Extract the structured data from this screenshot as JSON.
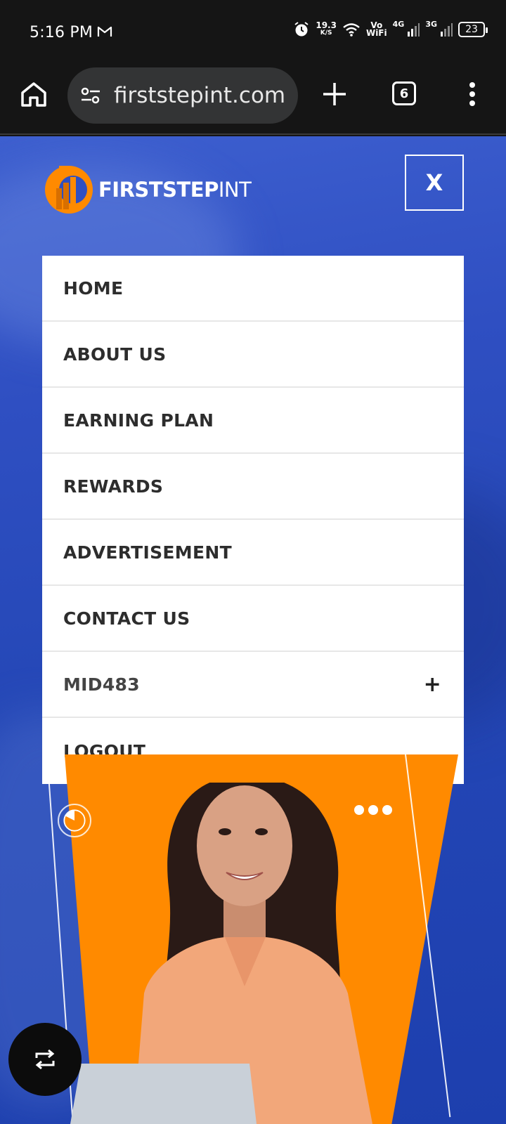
{
  "status_bar": {
    "time": "5:16 PM",
    "speed_value": "19.3",
    "speed_unit": "K/S",
    "volte_top": "Vo",
    "volte_bottom": "WiFi",
    "net1": "4G",
    "net2": "3G",
    "battery": "23"
  },
  "browser": {
    "url": "firststepint.com",
    "tab_count": "6"
  },
  "site": {
    "logo_bold": "FIRSTSTEP",
    "logo_light": "INT",
    "close_label": "X",
    "menu": [
      {
        "label": "HOME"
      },
      {
        "label": "ABOUT US"
      },
      {
        "label": "EARNING PLAN"
      },
      {
        "label": "REWARDS"
      },
      {
        "label": "ADVERTISEMENT"
      },
      {
        "label": "CONTACT US"
      },
      {
        "label": "MID483",
        "expand": "+"
      },
      {
        "label": "LOGOUT"
      }
    ]
  },
  "colors": {
    "brand_orange": "#ff8a00",
    "page_blue": "#2447b6"
  }
}
